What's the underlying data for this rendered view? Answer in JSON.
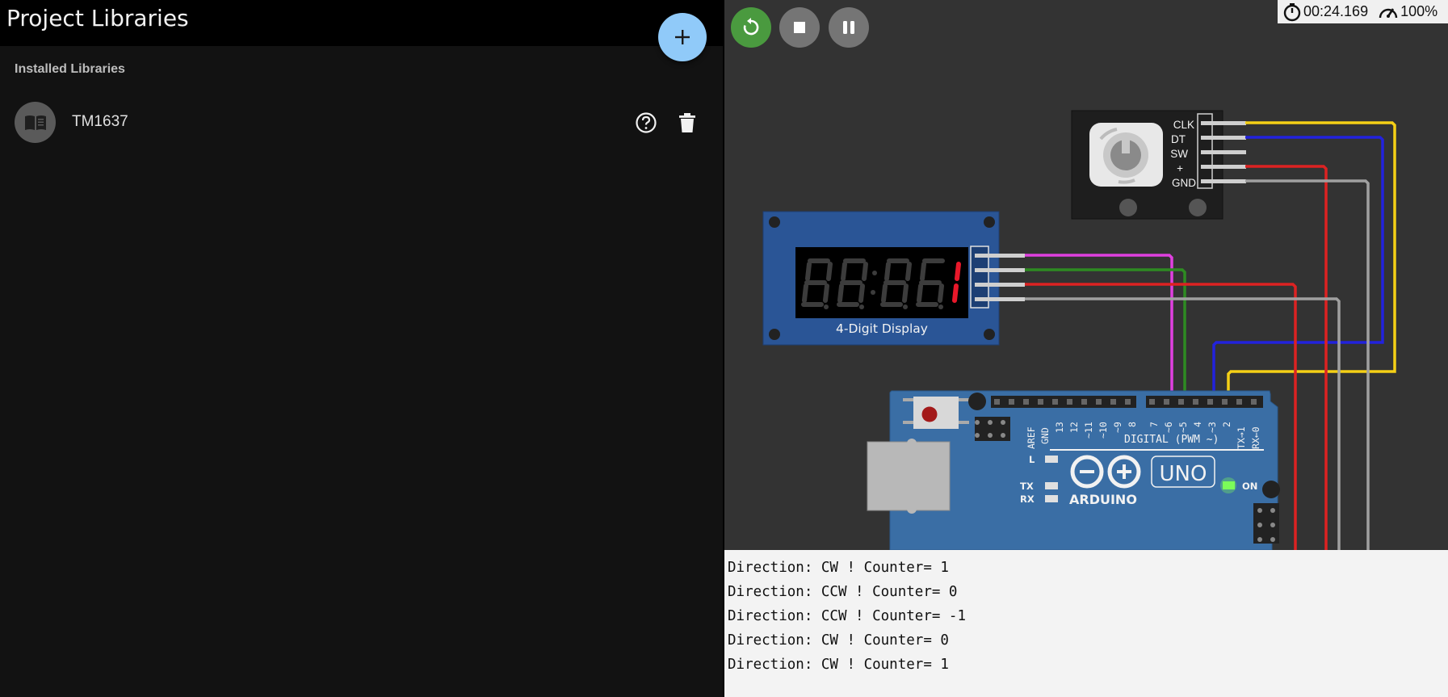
{
  "libraries_panel": {
    "title": "Project Libraries",
    "section_label": "Installed Libraries",
    "add_button_icon": "plus-icon",
    "items": [
      {
        "name": "TM1637",
        "icon": "book-icon"
      }
    ]
  },
  "simulator": {
    "timer": "00:24.169",
    "speed": "100%",
    "controls": [
      "restart-icon",
      "stop-icon",
      "pause-icon"
    ],
    "display": {
      "label": "4-Digit Display",
      "digit_value": "1"
    },
    "encoder": {
      "pins": [
        "CLK",
        "DT",
        "SW",
        "+",
        "GND"
      ]
    },
    "arduino": {
      "brand": "ARDUINO",
      "model": "UNO",
      "digital_label": "DIGITAL (PWM ~)",
      "header_pins": [
        "AREF",
        "GND",
        "13",
        "12",
        "~11",
        "~10",
        "~9",
        "8",
        "7",
        "~6",
        "~5",
        "4",
        "~3",
        "2",
        "TX→1",
        "RX←0"
      ],
      "led_labels": [
        "L",
        "TX",
        "RX"
      ],
      "power_label": "ON"
    },
    "colors": {
      "clk_wire": "#f5d016",
      "dt_wire": "#2222dd",
      "vcc_wire": "#dd2222",
      "gnd_wire": "#a0a0a0",
      "display_clk_wire": "#e040e0",
      "display_dio_wire": "#2e8b22",
      "board_blue": "#3a6ea5"
    }
  },
  "serial_monitor": {
    "lines": [
      "Direction: CW ! Counter= 1",
      "Direction: CCW ! Counter= 0",
      "Direction: CCW ! Counter= -1",
      "Direction: CW ! Counter= 0",
      "Direction: CW ! Counter= 1"
    ]
  }
}
